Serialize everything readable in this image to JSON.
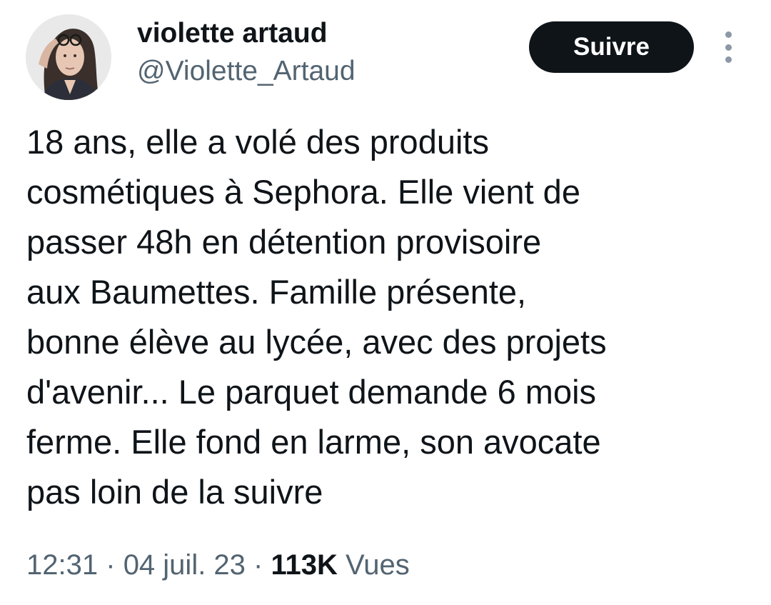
{
  "author": {
    "display_name": "violette artaud",
    "handle": "@Violette_Artaud",
    "avatar_icon": "profile-photo-woman-glasses"
  },
  "actions": {
    "follow_label": "Suivre",
    "more_icon": "vertical-ellipsis-icon"
  },
  "tweet": {
    "text_lines": [
      "18 ans, elle a volé des produits",
      "cosmétiques à Sephora. Elle vient de",
      "passer 48h en détention provisoire",
      "aux Baumettes. Famille présente,",
      "bonne élève au lycée, avec des projets",
      "d'avenir... Le parquet demande 6 mois",
      "ferme. Elle fond en larme, son avocate",
      "pas loin de la suivre"
    ]
  },
  "meta": {
    "time": "12:31",
    "separator": "·",
    "date": "04 juil. 23",
    "views_count": "113K",
    "views_label": "Vues"
  },
  "colors": {
    "text_primary": "#0f1419",
    "text_secondary": "#536471",
    "button_bg": "#0f1419",
    "button_text": "#ffffff"
  }
}
